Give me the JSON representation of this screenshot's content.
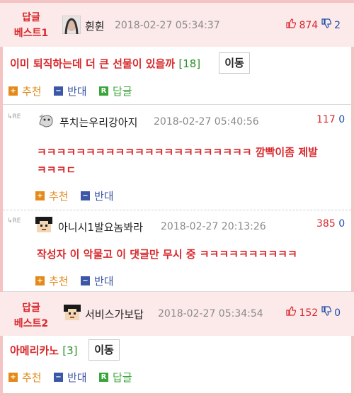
{
  "best1": {
    "label_line1": "답글",
    "label_line2": "베스트1",
    "nickname": "휜휜",
    "time": "2018-02-27 05:34:37",
    "up": "874",
    "down": "2",
    "comment": "이미 퇴직하는데 더 큰 선물이 있을까",
    "reply_count": "[18]",
    "move_label": "이동",
    "recommend_label": "추천",
    "oppose_label": "반대",
    "reply_label": "답글",
    "reply_badge": "R"
  },
  "reply1": {
    "re": "RE",
    "nickname": "푸치는우리강아지",
    "time": "2018-02-27 05:40:56",
    "up": "117",
    "down": "0",
    "comment_line1": "ㅋㅋㅋㅋㅋㅋㅋㅋㅋㅋㅋㅋㅋㅋㅋㅋㅋㅋㅋㅋㅋㅋ 깜빡이좀 제발",
    "comment_line2": "ㅋㅋㅋㄷ",
    "recommend_label": "추천",
    "oppose_label": "반대"
  },
  "reply2": {
    "re": "RE",
    "nickname": "아니시1발요놈봐라",
    "time": "2018-02-27 20:13:26",
    "up": "385",
    "down": "0",
    "comment": "작성자 이 악물고 이 댓글만 무시 중 ㅋㅋㅋㅋㅋㅋㅋㅋㅋㅋ",
    "recommend_label": "추천",
    "oppose_label": "반대"
  },
  "best2": {
    "label_line1": "답글",
    "label_line2": "베스트2",
    "nickname": "서비스가보답",
    "time": "2018-02-27 05:34:54",
    "up": "152",
    "down": "0",
    "comment": "아메리카노",
    "reply_count": "[3]",
    "move_label": "이동",
    "recommend_label": "추천",
    "oppose_label": "반대",
    "reply_label": "답글",
    "reply_badge": "R"
  },
  "icons": {
    "plus": "+",
    "minus": "−",
    "thumb_up": "👍",
    "thumb_down": "👎"
  },
  "colors": {
    "best_red": "#d8282c",
    "recommend_orange": "#e38a1a",
    "oppose_blue": "#3b57a6",
    "reply_green": "#3aa53a",
    "count_green": "#2a8f2a"
  }
}
